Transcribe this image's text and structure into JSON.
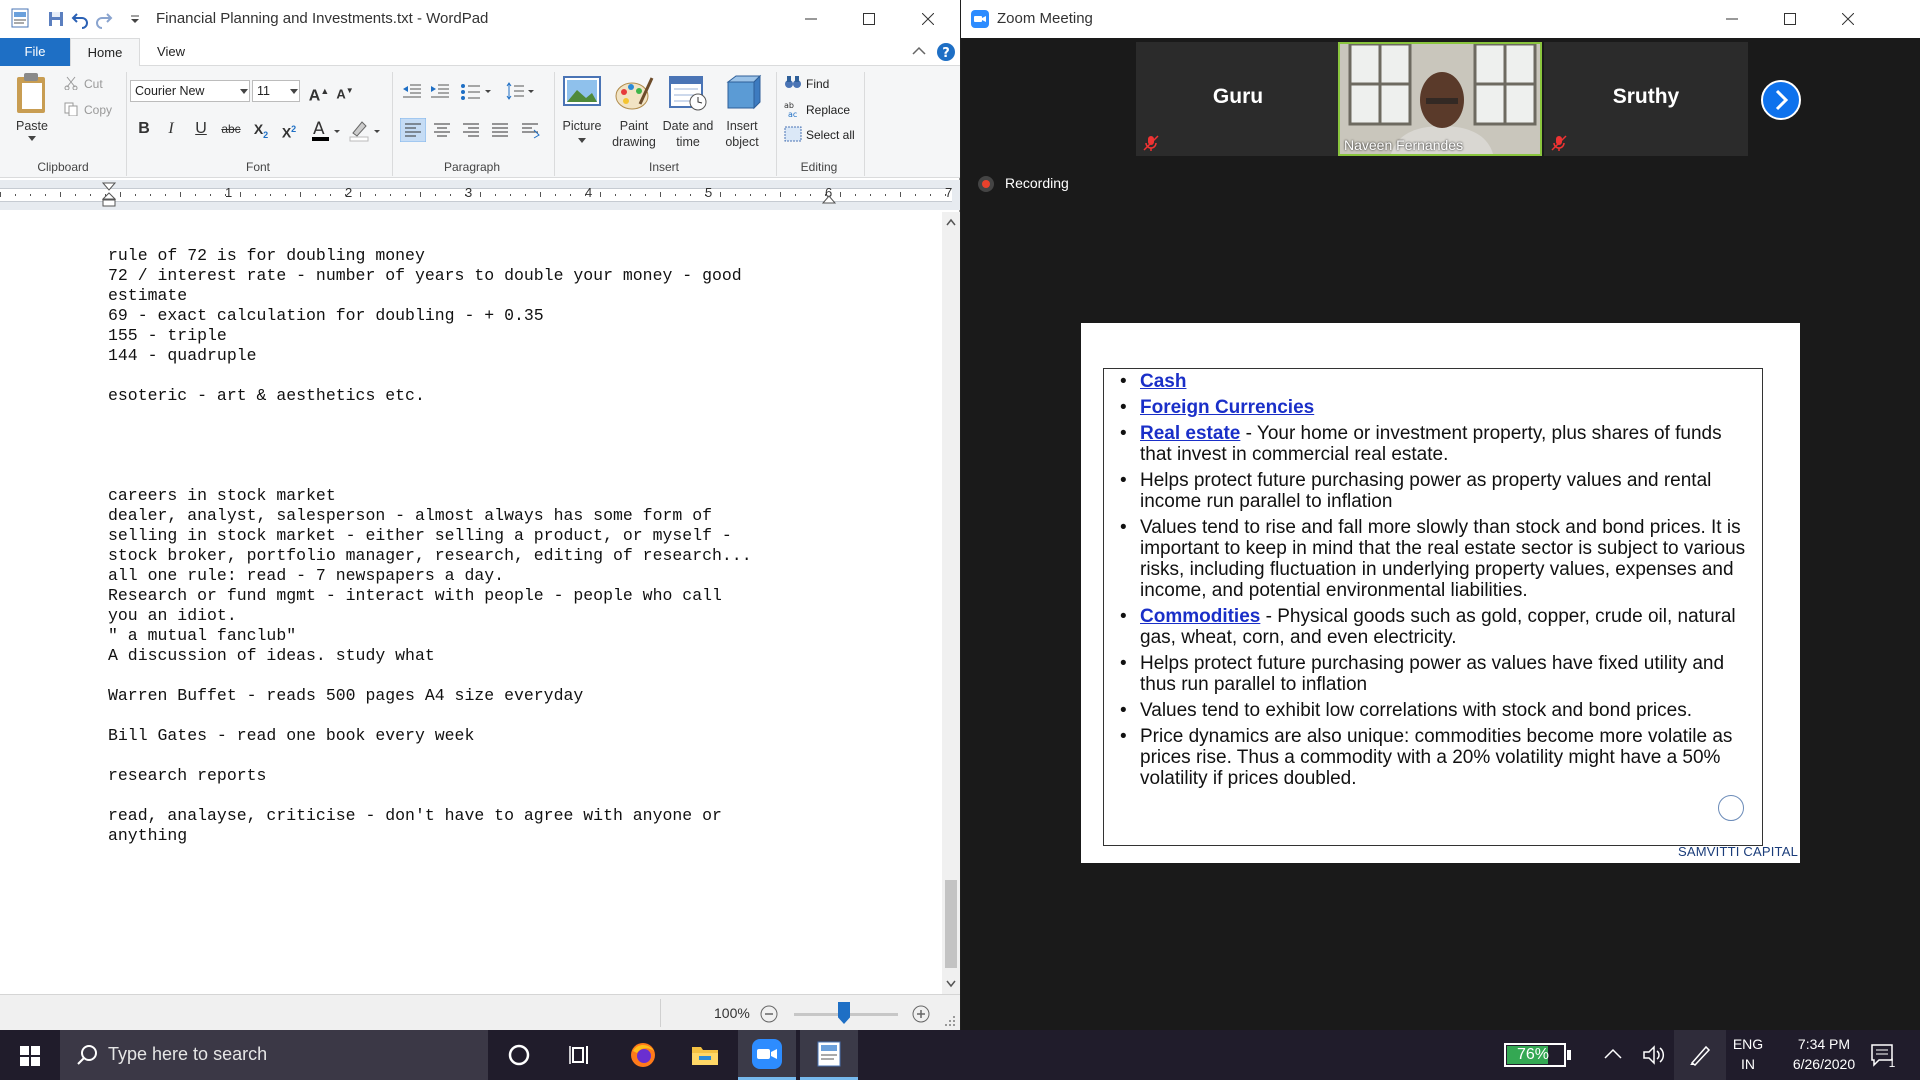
{
  "wordpad": {
    "title": "Financial Planning and Investments.txt - WordPad",
    "tabs": {
      "file": "File",
      "home": "Home",
      "view": "View"
    },
    "clipboard": {
      "paste": "Paste",
      "cut": "Cut",
      "copy": "Copy",
      "group": "Clipboard"
    },
    "font": {
      "family": "Courier New",
      "size": "11",
      "group": "Font"
    },
    "paragraph": {
      "group": "Paragraph"
    },
    "insert": {
      "picture": "Picture",
      "paint_1": "Paint",
      "paint_2": "drawing",
      "datetime_1": "Date and",
      "datetime_2": "time",
      "object_1": "Insert",
      "object_2": "object",
      "group": "Insert"
    },
    "editing": {
      "find": "Find",
      "replace": "Replace",
      "select_all": "Select all",
      "group": "Editing"
    },
    "ruler": [
      "1",
      "2",
      "3",
      "4",
      "5",
      "6",
      "7"
    ],
    "document_lines": [
      "rule of 72 is for doubling money",
      "72 / interest rate - number of years to double your money - good",
      "estimate",
      "69 - exact calculation for doubling - + 0.35",
      "155 - triple",
      "144 - quadruple",
      "",
      "esoteric - art & aesthetics etc.",
      "",
      "",
      "",
      "",
      "careers in stock market",
      "dealer, analyst, salesperson - almost always has some form of",
      "selling in stock market - either selling a product, or myself -",
      "stock broker, portfolio manager, research, editing of research...",
      "all one rule: read - 7 newspapers a day.",
      "Research or fund mgmt - interact with people - people who call",
      "you an idiot.",
      "\" a mutual fanclub\"",
      "A discussion of ideas. study what",
      "",
      "Warren Buffet - reads 500 pages A4 size everyday",
      "",
      "Bill Gates - read one book every week",
      "",
      "research reports",
      "",
      "read, analayse, criticise - don't have to agree with anyone or",
      "anything"
    ],
    "zoom": "100%"
  },
  "zoom_app": {
    "title": "Zoom Meeting",
    "participants": {
      "left": "Guru",
      "video": "Naveen Fernandes",
      "right": "Sruthy"
    },
    "recording": "Recording",
    "slide": {
      "bullets": [
        {
          "link": "Cash",
          "text": ""
        },
        {
          "link": "Foreign Currencies",
          "text": ""
        },
        {
          "link": "Real estate",
          "text": " - Your home or investment property, plus shares of funds that invest in commercial real estate."
        },
        {
          "link": "",
          "text": "Helps protect future purchasing power as property values and rental income run parallel to inflation"
        },
        {
          "link": "",
          "text": "Values tend to rise and fall more slowly than stock and bond prices. It is important to keep in mind that the real estate sector is subject to various risks, including fluctuation in underlying property values, expenses and income, and potential environmental liabilities."
        },
        {
          "link": "Commodities",
          "text": " - Physical goods such as gold, copper, crude oil, natural gas, wheat, corn, and even electricity."
        },
        {
          "link": "",
          "text": "Helps protect future purchasing power as values have fixed utility and thus run parallel to inflation"
        },
        {
          "link": "",
          "text": "Values tend to exhibit low correlations with stock and bond prices."
        },
        {
          "link": "",
          "text": "Price dynamics are also unique: commodities become more volatile as prices rise. Thus a commodity with a 20% volatility might have a 50% volatility if prices doubled."
        }
      ],
      "brand": "SAMVITTI CAPITAL"
    }
  },
  "taskbar": {
    "search_placeholder": "Type here to search",
    "battery": "76%",
    "battery_level": 0.76,
    "lang_1": "ENG",
    "lang_2": "IN",
    "time": "7:34 PM",
    "date": "6/26/2020",
    "notifications": "1"
  },
  "colors": {
    "accent": "#1e6fc5",
    "zoom_blue": "#0e72ed",
    "link": "#1a2fc8",
    "taskbar": "#201c2b"
  }
}
